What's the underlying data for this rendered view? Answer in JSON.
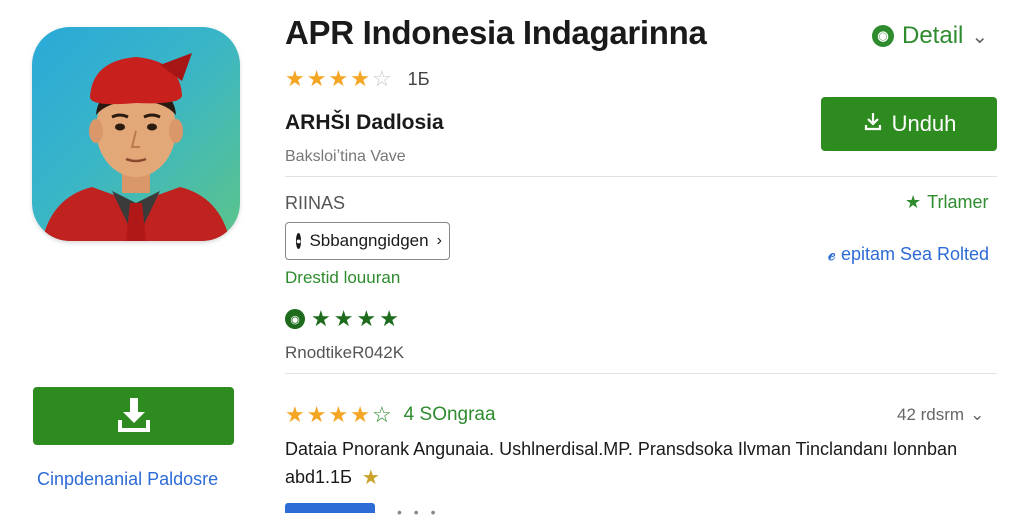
{
  "app": {
    "title": "APR Indonesia Indagarinna",
    "developer": "ARHŠI Dadlosia",
    "subtitle": "Baksloiʼtina Vave",
    "rating_count": "1Ƃ",
    "icon_desc": "app-icon-portrait"
  },
  "header": {
    "detail_label": "Detail"
  },
  "actions": {
    "install_label": "Unduh"
  },
  "info": {
    "section_label": "RIINAS",
    "trending_label": "Trlamer",
    "chip_label": "Sbbangngidgen",
    "right_link": "epitam Sea Rolted",
    "green_link": "Drestid louuran",
    "downloads": "RnodtikeR042K"
  },
  "sidebar": {
    "caption": "Cinpdenanial Paldosre"
  },
  "reviews": {
    "rating_text": "4 SOngraa",
    "right_text": "42 rdsrm",
    "description_line1": "Dataia Pnorank Angunaia. Ushlnerdisal.MP. Pransdsoka Ilvman Tincland­anı lonnban",
    "description_line2": "abd1.1Ƃ"
  },
  "colors": {
    "accent_green": "#2e8b1f",
    "link_blue": "#2d6bd6",
    "star_orange": "#f5a524"
  }
}
